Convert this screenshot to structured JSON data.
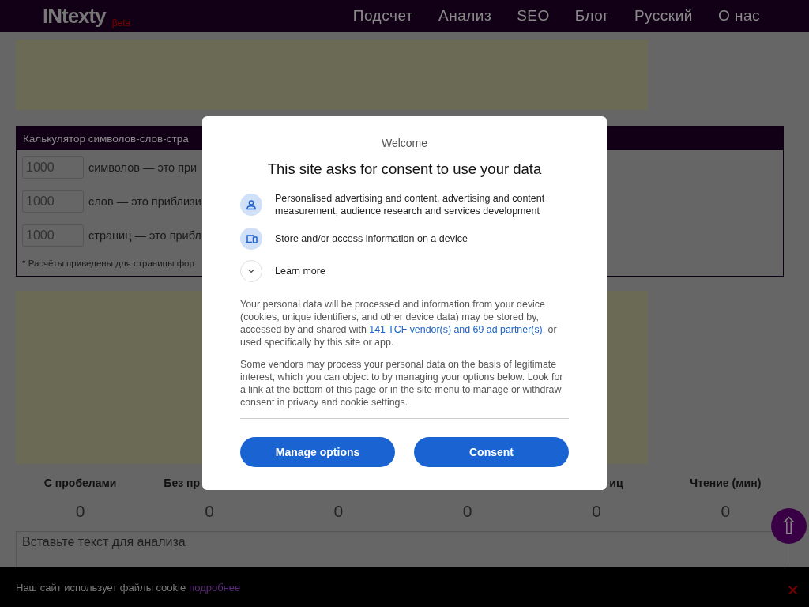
{
  "header": {
    "logo": "INtexty",
    "badge": "βeta",
    "nav": [
      {
        "label": "Подсчет"
      },
      {
        "label": "Анализ"
      },
      {
        "label": "SEO"
      },
      {
        "label": "Блог"
      },
      {
        "label": "Русский"
      },
      {
        "label": "О нас"
      }
    ]
  },
  "calculator": {
    "title": "Калькулятор символов-слов-стра",
    "rows": [
      {
        "value": "1000",
        "text": "символов — это при"
      },
      {
        "value": "1000",
        "text": "слов — это приблизи"
      },
      {
        "value": "1000",
        "text": "страниц — это прибл"
      }
    ],
    "note": "* Расчёты приведены для страницы фор"
  },
  "stats": [
    {
      "label": "С пробелами",
      "value": "0"
    },
    {
      "label": "Без пр",
      "value": "0"
    },
    {
      "value": "0"
    },
    {
      "value": "0"
    },
    {
      "label": "иц",
      "value": "0"
    },
    {
      "label": "Чтение (мин)",
      "value": "0"
    }
  ],
  "text_input": {
    "placeholder": "Вставьте текст для анализа"
  },
  "scroll_top": {
    "label": "⇧"
  },
  "cookie_bar": {
    "text": "Наш сайт использует файлы cookie",
    "link": "подробнее",
    "close": "✕"
  },
  "consent_dialog": {
    "welcome": "Welcome",
    "title": "This site asks for consent to use your data",
    "purposes": [
      {
        "kind": "person",
        "text": "Personalised advertising and content, advertising and content measurement, audience research and services development"
      },
      {
        "kind": "device",
        "text": "Store and/or access information on a device"
      },
      {
        "kind": "expand",
        "text": "Learn more"
      }
    ],
    "paragraphs": [
      {
        "text": "Your personal data will be processed and information from your device (cookies, unique identifiers, and other device data) may be stored by, accessed by and shared with ",
        "link": "141 TCF vendor(s) and 69 ad partner(s)",
        "after": ", or used specifically by this site or app."
      },
      {
        "text": "Some vendors may process your personal data on the basis of legitimate interest, which you can object to by managing your options below. Look for a link at the bottom of this page or in the site menu to manage or withdraw consent in privacy and cookie settings."
      }
    ],
    "buttons": [
      "Manage options",
      "Consent"
    ]
  }
}
